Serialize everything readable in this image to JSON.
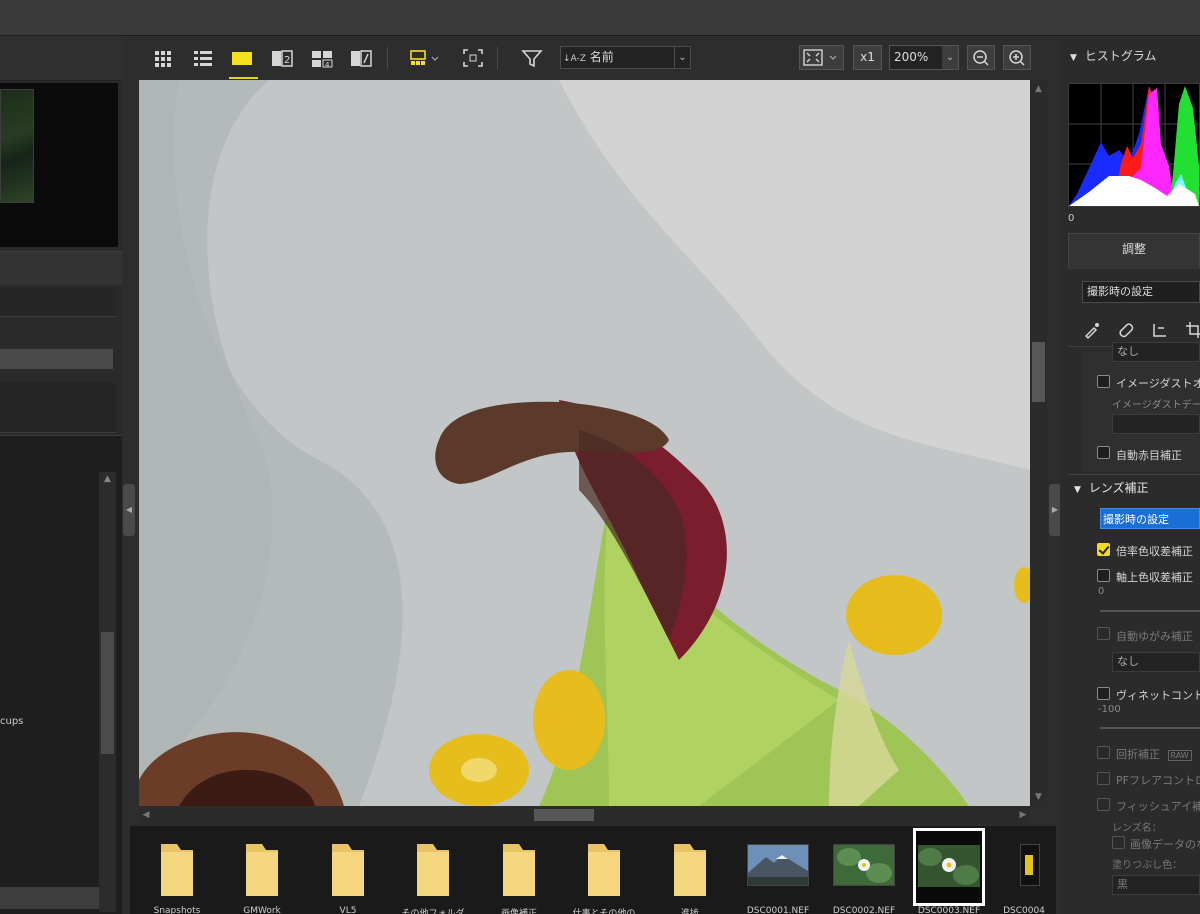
{
  "toolbar": {
    "sort_label": "名前",
    "sort_prefix": "↓A-Z",
    "fit_chevron": "⌄",
    "x1_label": "x1",
    "zoom_value": "200%"
  },
  "left_panel": {
    "tree_label_visible": "cups"
  },
  "filmstrip": {
    "items": [
      {
        "name": "Snapshots"
      },
      {
        "name": "GMWork"
      },
      {
        "name": "VL5"
      },
      {
        "name": "その他フォルダ"
      },
      {
        "name": "画像補正"
      },
      {
        "name": "仕事とその他の"
      },
      {
        "name": "進捗"
      },
      {
        "name": "DSC0001.NEF"
      },
      {
        "name": "DSC0002.NEF"
      },
      {
        "name": "DSC0003.NEF"
      },
      {
        "name": "DSC0004"
      }
    ]
  },
  "right_panel": {
    "histogram_title": "ヒストグラム",
    "histogram_min": "0",
    "adjust_tab": "調整",
    "preset_select": "撮影時の設定",
    "rows": {
      "none1": "なし",
      "image_dust_off": "イメージダストオフ",
      "image_dust_data": "イメージダストデータ",
      "auto_redeye": "自動赤目補正",
      "lens_correction": "レンズ補正",
      "lens_preset": "撮影時の設定",
      "lateral_ca": "倍率色収差補正",
      "axial_ca": "軸上色収差補正",
      "axial_value": "0",
      "auto_distortion": "自動ゆがみ補正",
      "none2": "なし",
      "vignette": "ヴィネットコントロール",
      "vignette_value": "-100",
      "diffraction": "回折補正",
      "raw_badge": "RAW",
      "pf_flare": "PFフレアコントロール",
      "fisheye": "フィッシュアイ補正",
      "lens_name": "レンズ名：",
      "image_data": "画像データのない",
      "fill_color": "塗りつぶし色：",
      "fill_black": "黒"
    }
  },
  "colors": {
    "accent": "#e8d21e",
    "selection_blue": "#1a6fd6"
  }
}
